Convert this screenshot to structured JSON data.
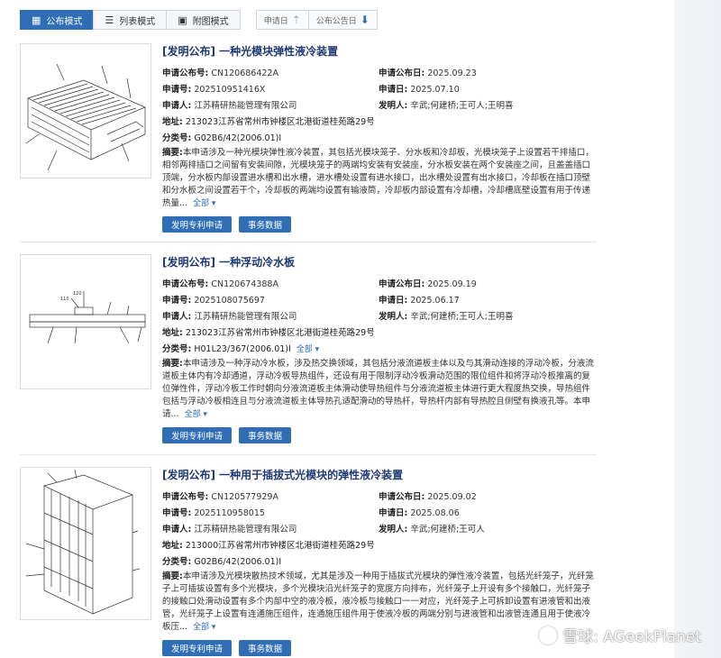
{
  "toolbar": {
    "tabs": [
      {
        "label": "公布模式",
        "icon": "grid-icon",
        "active": true
      },
      {
        "label": "列表模式",
        "icon": "list-icon",
        "active": false
      },
      {
        "label": "附图模式",
        "icon": "image-grid-icon",
        "active": false
      }
    ],
    "sorts": [
      {
        "label": "申请日",
        "icon": "arrow-up-icon"
      },
      {
        "label": "公布公告日",
        "icon": "arrow-down-icon"
      }
    ]
  },
  "labels": {
    "pub_no": "申请公布号:",
    "pub_date": "申请公布日:",
    "app_no": "申请号:",
    "app_date": "申请日:",
    "applicant": "申请人:",
    "inventor": "发明人:",
    "address": "地址:",
    "ipc": "分类号:",
    "abstract": "摘要:",
    "more": "全部 ▾",
    "btn_apply": "发明专利申请",
    "btn_data": "事务数据"
  },
  "patents": [
    {
      "title": "[发明公布] 一种光模块弹性液冷装置",
      "pub_no": "CN120686422A",
      "pub_date": "2025.09.23",
      "app_no": "202510951416X",
      "app_date": "2025.07.10",
      "applicant": "江苏精研热能管理有限公司",
      "inventor": "辛武;何建桥;王可人;王明喜",
      "address": "213023江苏省常州市钟楼区北港街道桂苑路29号",
      "ipc": "G02B6/42(2006.01)I",
      "abstract": "本申请涉及一种光模块弹性液冷装置，其包括光模块笼子、分水板和冷却板，光模块笼子上设置若干排插口，相邻两排插口之间留有安装间隙，光模块笼子的两端均安装有安装座，分水板安装在两个安装座之间，且盖盖插口顶端，分水板内部设置进水槽和出水槽，进水槽处设置有进水接口，出水槽处设置有出水接口，冷却板在插口顶壁和分水板之间设置若干个，冷却板的两端均设置有输液筒，冷却板内部设置有冷却槽，冷却槽底壁设置有用于传递热量..."
    },
    {
      "title": "[发明公布] 一种浮动冷水板",
      "pub_no": "CN120674388A",
      "pub_date": "2025.09.19",
      "app_no": "2025108075697",
      "app_date": "2025.06.17",
      "applicant": "江苏精研热能管理有限公司",
      "inventor": "辛武;何建桥;王可人;王明喜",
      "address": "213023江苏省常州市钟楼区北港街道桂苑路29号",
      "ipc": "H01L23/367(2006.01)I",
      "abstract": "本申请涉及一种浮动冷水板，涉及热交换领域，其包括分液流道板主体以及与其滑动连接的浮动冷板，分液流道板主体内有冷却通道，浮动冷板导热组件，还设有用于限制浮动冷板滑动范围的限位组件和将浮动冷板推离的复位弹性件，浮动冷板工作时朝向分液流道板主体滑动使导热组件与分液流道板主体进行更大程度热交换，导热组件包括与浮动冷板相连且与分液流道板主体导热孔适配滑动的导热杆，导热杆内部有导热腔且侧壁有换液孔等。本申请..."
    },
    {
      "title": "[发明公布] 一种用于插拔式光模块的弹性液冷装置",
      "pub_no": "CN120577929A",
      "pub_date": "2025.09.02",
      "app_no": "2025110958015",
      "app_date": "2025.08.06",
      "applicant": "江苏精研热能管理有限公司",
      "inventor": "辛武;何建桥;王可人",
      "address": "213000江苏省常州市钟楼区北港街道桂苑路29号",
      "ipc": "G02B6/42(2006.01)I",
      "abstract": "本申请涉及光模块散热技术领域，尤其是涉及一种用于插拔式光模块的弹性液冷装置，包括光纤笼子，光纤笼子上可插拔设置有多个光模块，多个光模块沿光纤笼子的宽度方向排布，光纤笼子上开设有多个接触口，光纤笼子的接触口处滑动设置有多个内部中空的液冷板，液冷板与接触口一一对应，光纤笼子上可拆卸设置有进液管和出液管，光纤笼子上设置有连通施压组件，连通施压组件用于使液冷板的两端分别与进液管和出液管连通且用于使液冷板压..."
    }
  ],
  "watermark": "雪球: AGeekPlanet"
}
